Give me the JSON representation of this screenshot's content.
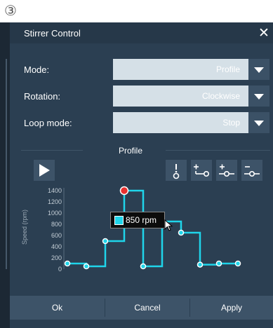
{
  "step_label": "③",
  "dialog": {
    "title": "Stirrer Control",
    "close_glyph": "✕"
  },
  "rows": [
    {
      "label": "Mode:",
      "value": "Profile"
    },
    {
      "label": "Rotation:",
      "value": "Clockwise"
    },
    {
      "label": "Loop mode:",
      "value": "Stop"
    }
  ],
  "profile": {
    "title": "Profile",
    "tools": [
      "play-icon",
      "add-point-before-icon",
      "add-point-after-icon",
      "add-point-between-icon",
      "remove-point-icon"
    ],
    "tooltip": "850 rpm"
  },
  "chart_data": {
    "type": "line",
    "ylabel": "Speed (rpm)",
    "yticks": [
      "0",
      "200",
      "400",
      "600",
      "800",
      "1000",
      "1200",
      "1400"
    ],
    "ylim": [
      0,
      1500
    ],
    "points": [
      {
        "x": 1,
        "y": 100
      },
      {
        "x": 2,
        "y": 50
      },
      {
        "x": 3,
        "y": 500
      },
      {
        "x": 4,
        "y": 1400,
        "selected": true
      },
      {
        "x": 5,
        "y": 50
      },
      {
        "x": 6,
        "y": 850
      },
      {
        "x": 7,
        "y": 650
      },
      {
        "x": 8,
        "y": 80
      },
      {
        "x": 9,
        "y": 100
      },
      {
        "x": 10,
        "y": 100
      }
    ],
    "line_color": "#1fd5ea",
    "selected_color": "#e8302e"
  },
  "buttons": {
    "ok": "Ok",
    "cancel": "Cancel",
    "apply": "Apply"
  },
  "colors": {
    "dialog_bg": "#2b3f52",
    "field_bg": "#d5e0e7",
    "button_bg": "#3d5368"
  }
}
